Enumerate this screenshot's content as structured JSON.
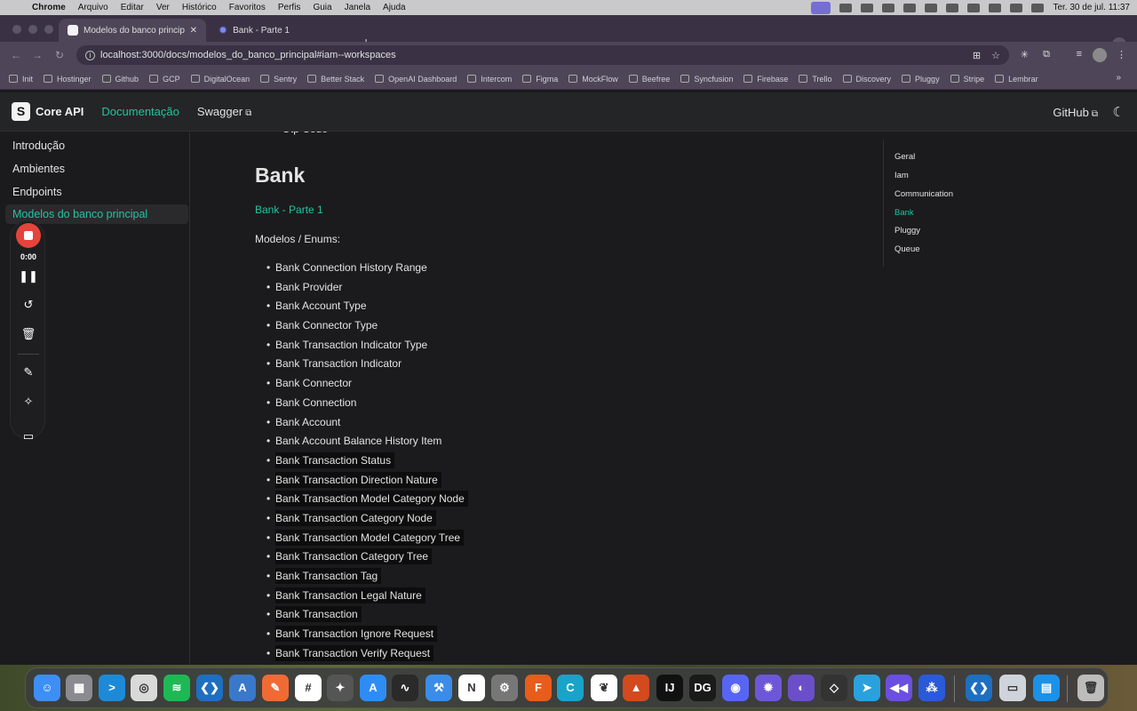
{
  "menubar": {
    "app": "Chrome",
    "items": [
      "Arquivo",
      "Editar",
      "Ver",
      "Histórico",
      "Favoritos",
      "Perfis",
      "Guia",
      "Janela",
      "Ajuda"
    ],
    "clock": "Ter. 30 de jul.  11:37"
  },
  "tabs": [
    {
      "title": "Modelos do banco principal |",
      "active": true
    },
    {
      "title": "Bank - Parte 1",
      "active": false
    }
  ],
  "address": {
    "url": "localhost:3000/docs/modelos_do_banco_principal#iam--workspaces"
  },
  "bookmarks": [
    "Init",
    "Hostinger",
    "Github",
    "GCP",
    "DigitalOcean",
    "Sentry",
    "Better Stack",
    "OpenAI Dashboard",
    "Intercom",
    "Figma",
    "MockFlow",
    "Beefree",
    "Syncfusion",
    "Firebase",
    "Trello",
    "Discovery",
    "Pluggy",
    "Stripe",
    "Lembrar"
  ],
  "docnav": {
    "brand": "Core API",
    "links": [
      "Documentação",
      "Swagger"
    ],
    "github": "GitHub"
  },
  "sidebar": {
    "items": [
      "Introdução",
      "Ambientes",
      "Endpoints",
      "Modelos do banco principal"
    ],
    "active_index": 3
  },
  "recorder": {
    "time": "0:00"
  },
  "content": {
    "cut_item": "Otp Code",
    "heading": "Bank",
    "link": "Bank - Parte 1",
    "intro": "Modelos / Enums:",
    "items": [
      "Bank Connection History Range",
      "Bank Provider",
      "Bank Account Type",
      "Bank Connector Type",
      "Bank Transaction Indicator Type",
      "Bank Transaction Indicator",
      "Bank Connector",
      "Bank Connection",
      "Bank Account",
      "Bank Account Balance History Item",
      "Bank Transaction Status",
      "Bank Transaction Direction Nature",
      "Bank Transaction Model Category Node",
      "Bank Transaction Category Node",
      "Bank Transaction Model Category Tree",
      "Bank Transaction Category Tree",
      "Bank Transaction Tag",
      "Bank Transaction Legal Nature",
      "Bank Transaction",
      "Bank Transaction Ignore Request",
      "Bank Transaction Verify Request"
    ],
    "selected_from_index": 10
  },
  "toc": {
    "items": [
      "Geral",
      "Iam",
      "Communication",
      "Bank",
      "Pluggy",
      "Queue"
    ],
    "active_index": 3
  },
  "dock": {
    "apps": [
      {
        "name": "finder-icon",
        "color": "#3d8ff5",
        "glyph": "☺"
      },
      {
        "name": "launchpad-icon",
        "color": "#8a8a90",
        "glyph": "▦"
      },
      {
        "name": "terminal-icon",
        "color": "#1d8ad8",
        "glyph": ">"
      },
      {
        "name": "chrome-icon",
        "color": "#d9d9d9",
        "glyph": "◎"
      },
      {
        "name": "spotify-icon",
        "color": "#1db954",
        "glyph": "≋"
      },
      {
        "name": "vscode-icon",
        "color": "#1e6fc0",
        "glyph": "❮❯"
      },
      {
        "name": "azure-data-studio-icon",
        "color": "#3a78c9",
        "glyph": "A"
      },
      {
        "name": "pencil-app-icon",
        "color": "#f06a35",
        "glyph": "✎"
      },
      {
        "name": "slack-icon",
        "color": "#ffffff",
        "glyph": "#"
      },
      {
        "name": "goose-icon",
        "color": "#555555",
        "glyph": "✦"
      },
      {
        "name": "app-store-icon",
        "color": "#2e8df5",
        "glyph": "A"
      },
      {
        "name": "activity-monitor-icon",
        "color": "#2a2a2a",
        "glyph": "∿"
      },
      {
        "name": "xcode-icon",
        "color": "#3b8ce8",
        "glyph": "⚒"
      },
      {
        "name": "notion-icon",
        "color": "#ffffff",
        "glyph": "N"
      },
      {
        "name": "system-settings-icon",
        "color": "#777777",
        "glyph": "⚙"
      },
      {
        "name": "fusion-icon",
        "color": "#e85c1c",
        "glyph": "F"
      },
      {
        "name": "cursor-icon",
        "color": "#1aa3c8",
        "glyph": "C"
      },
      {
        "name": "mongodb-icon",
        "color": "#ffffff",
        "glyph": "❦"
      },
      {
        "name": "matlab-icon",
        "color": "#d24a1e",
        "glyph": "▲"
      },
      {
        "name": "intellij-icon",
        "color": "#111111",
        "glyph": "IJ"
      },
      {
        "name": "datagrip-icon",
        "color": "#1a1a1a",
        "glyph": "DG"
      },
      {
        "name": "discord-icon",
        "color": "#5865f2",
        "glyph": "◉"
      },
      {
        "name": "settings-gear-icon",
        "color": "#6d57d6",
        "glyph": "✹"
      },
      {
        "name": "proton-icon",
        "color": "#6a4fc9",
        "glyph": "◐"
      },
      {
        "name": "unity-icon",
        "color": "#333333",
        "glyph": "◇"
      },
      {
        "name": "telegram-icon",
        "color": "#2aa1dc",
        "glyph": "➤"
      },
      {
        "name": "rewind-icon",
        "color": "#6a4fe0",
        "glyph": "◀◀"
      },
      {
        "name": "network-app-icon",
        "color": "#2b5ad8",
        "glyph": "⁂"
      },
      {
        "name": "vscode-insiders-icon",
        "color": "#1e6fc0",
        "glyph": "❮❯"
      },
      {
        "name": "screen-app-icon",
        "color": "#cfd3da",
        "glyph": "▭"
      },
      {
        "name": "docker-icon",
        "color": "#1d91e6",
        "glyph": "▤"
      },
      {
        "name": "trash-icon",
        "color": "#bcbcbc",
        "glyph": "🗑"
      }
    ]
  }
}
